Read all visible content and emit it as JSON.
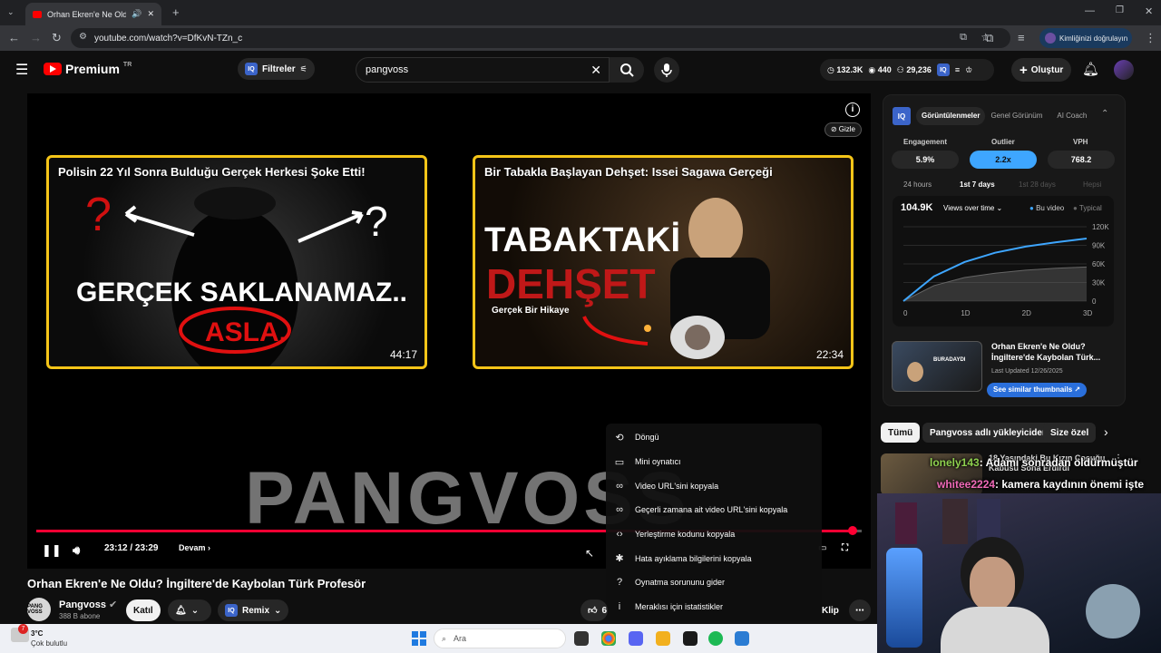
{
  "browser": {
    "tab_title": "Orhan Ekren'e Ne Oldu? İn...",
    "url": "youtube.com/watch?v=DfKvN-TZn_c",
    "identity_button": "Kimliğinizi doğrulayın"
  },
  "header": {
    "logo_text": "Premium",
    "logo_region": "TR",
    "filters_label": "Filtreler",
    "search_value": "pangvoss",
    "stats": {
      "views": "132.3K",
      "watching": "440",
      "subscribers": "29,236"
    },
    "create_label": "Oluştur"
  },
  "player": {
    "hide_label": "Gizle",
    "end_cards": [
      {
        "title": "Polisin 22 Yıl Sonra Bulduğu Gerçek Herkesi Şoke Etti!",
        "duration": "44:17",
        "overlay_main": "GERÇEK SAKLANAMAZ..",
        "overlay_sub": "ASLA."
      },
      {
        "title": "Bir Tabakla Başlayan Dehşet: Issei Sagawa Gerçeği",
        "duration": "22:34",
        "overlay_main": "TABAKTAKİ",
        "overlay_sub": "DEHŞET",
        "overlay_small": "Gerçek Bir Hikaye"
      }
    ],
    "watermark": "PANGVOSS",
    "time": "23:12 / 23:29",
    "continue_label": "Devam",
    "progress": 0.985
  },
  "context_menu": [
    {
      "icon": "loop-icon",
      "glyph": "⟲",
      "label": "Döngü"
    },
    {
      "icon": "miniplayer-icon",
      "glyph": "▭",
      "label": "Mini oynatıcı"
    },
    {
      "icon": "link-icon",
      "glyph": "∞",
      "label": "Video URL'sini kopyala"
    },
    {
      "icon": "link-time-icon",
      "glyph": "∞",
      "label": "Geçerli zamana ait video URL'sini kopyala"
    },
    {
      "icon": "embed-icon",
      "glyph": "‹›",
      "label": "Yerleştirme kodunu kopyala"
    },
    {
      "icon": "bug-icon",
      "glyph": "✱",
      "label": "Hata ayıklama bilgilerini kopyala"
    },
    {
      "icon": "help-icon",
      "glyph": "?",
      "label": "Oynatma sorununu gider"
    },
    {
      "icon": "info-icon",
      "glyph": "i",
      "label": "Meraklısı için istatistikler"
    }
  ],
  "video": {
    "title": "Orhan Ekren'e Ne Oldu? İngiltere'de Kaybolan Türk Profesör",
    "channel_avatar_text": "PANG VOSS",
    "channel": "Pangvoss",
    "subscribers": "388 B abone",
    "join_label": "Katıl",
    "remix_label": "Remix",
    "like_count": "6",
    "clip_label": "Klip"
  },
  "iq_panel": {
    "tabs": [
      "Görüntülenmeler",
      "Genel Görünüm",
      "AI Coach"
    ],
    "metrics": [
      {
        "label": "Engagement",
        "value": "5.9%"
      },
      {
        "label": "Outlier",
        "value": "2.2x"
      },
      {
        "label": "VPH",
        "value": "768.2"
      }
    ],
    "ranges": [
      "24 hours",
      "1st 7 days",
      "1st 28 days",
      "Hepsi"
    ],
    "total": "104.9K",
    "views_dropdown": "Views over time",
    "legend": [
      "Bu video",
      "Typical"
    ],
    "similar": {
      "title": "Orhan Ekren'e Ne Oldu? İngiltere'de Kaybolan Türk...",
      "updated": "Last Updated 12/26/2025",
      "button": "See similar thumbnails",
      "thumb_text": "BURADAYDI"
    }
  },
  "chart_data": {
    "type": "line",
    "x_ticks": [
      "0",
      "1D",
      "2D",
      "3D"
    ],
    "y_ticks": [
      "120K",
      "90K",
      "60K",
      "30K",
      "0"
    ],
    "ylim": [
      0,
      120000
    ],
    "xlim": [
      0,
      3
    ],
    "series": [
      {
        "name": "Bu video",
        "color": "#3ea6ff",
        "x": [
          0,
          0.5,
          1,
          1.5,
          2,
          2.5,
          3
        ],
        "y": [
          0,
          40000,
          63000,
          78000,
          88000,
          95000,
          101000
        ]
      },
      {
        "name": "Typical",
        "color": "#666666",
        "x": [
          0,
          0.5,
          1,
          1.5,
          2,
          2.5,
          3
        ],
        "y": [
          0,
          25000,
          38000,
          45000,
          50000,
          53000,
          55000
        ]
      }
    ]
  },
  "recommend": {
    "chips": [
      "Tümü",
      "Pangvoss adlı yükleyiciden",
      "Size özel"
    ],
    "first_title": "18 Yaşındaki Bu Kızın Çocuğu Kâbusu Sona Erdirdi"
  },
  "webcam": {
    "chat_lines": [
      {
        "user": "lonely143",
        "text": ": Adamı sonradan öldürmüştür"
      },
      {
        "user": "whitee2224",
        "text": ": kamera kaydının önemi işte"
      }
    ]
  },
  "taskbar": {
    "weather_temp": "3°C",
    "weather_desc": "Çok bulutlu",
    "weather_badge": "7",
    "search_placeholder": "Ara"
  },
  "colors": {
    "accent": "#3ea6ff",
    "progress": "#ff0033",
    "card_border": "#f5c518",
    "brand": "#ff0000"
  }
}
